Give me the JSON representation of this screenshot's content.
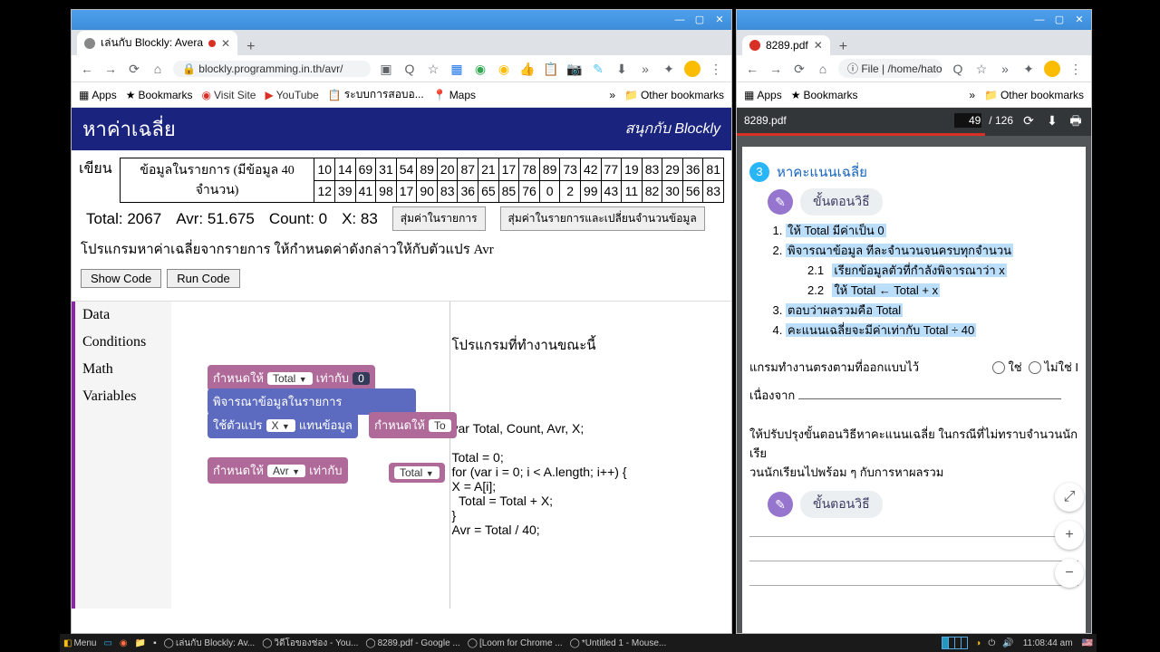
{
  "left": {
    "tab_title": "เล่นกับ Blockly: Avera",
    "url": "blockly.programming.in.th/avr/",
    "bookmarks": [
      "Apps",
      "Bookmarks",
      "Visit Site",
      "YouTube",
      "ระบบการสอบอ...",
      "Maps",
      "Other bookmarks"
    ],
    "page_h1": "หาค่าเฉลี่ย",
    "page_sub": "สนุกกับ Blockly",
    "label_write": "เขียน",
    "data_label": "ข้อมูลในรายการ (มีข้อมูล 40 จำนวน)",
    "nums_r1": [
      "10",
      "14",
      "69",
      "31",
      "54",
      "89",
      "20",
      "87",
      "21",
      "17",
      "78",
      "89",
      "73",
      "42",
      "77",
      "19",
      "83",
      "29",
      "36",
      "81"
    ],
    "nums_r2": [
      "12",
      "39",
      "41",
      "98",
      "17",
      "90",
      "83",
      "36",
      "65",
      "85",
      "76",
      "0",
      "2",
      "99",
      "43",
      "11",
      "82",
      "30",
      "56",
      "83"
    ],
    "stats": {
      "total": "Total: 2067",
      "avr": "Avr: 51.675",
      "count": "Count: 0",
      "x": "X: 83"
    },
    "btn_rand1": "สุ่มค่าในรายการ",
    "btn_rand2": "สุ่มค่าในรายการและเปลี่ยนจำนวนข้อมูล",
    "desc": "โปรแกรมหาค่าเฉลี่ยจากรายการ ให้กำหนดค่าดังกล่าวให้กับตัวแปร Avr",
    "show_code": "Show Code",
    "run_code": "Run Code",
    "cats": [
      "Data",
      "Conditions",
      "Math",
      "Variables"
    ],
    "code_title": "โปรแกรมที่ทำงานขณะนี้",
    "code": "var Total, Count, Avr, X;\n\nTotal = 0;\nfor (var i = 0; i < A.length; i++) {\nX = A[i];\n  Total = Total + X;\n}\nAvr = Total / 40;",
    "b1_a": "กำหนดให้",
    "b1_var": "Total",
    "b1_b": "เท่ากับ",
    "b1_val": "0",
    "b2": "พิจารณาข้อมูลในรายการ",
    "b3_a": "ใช้ตัวแปร",
    "b3_var": "X",
    "b3_b": "แทนข้อมูล",
    "b3_c": "กำหนดให้",
    "b3_d": "To",
    "b4_a": "กำหนดให้",
    "b4_var": "Avr",
    "b4_b": "เท่ากับ",
    "b4_pill": "Total"
  },
  "right": {
    "tab_title": "8289.pdf",
    "url": "File | /home/hatori/D...",
    "bookmarks": [
      "Apps",
      "Bookmarks",
      "Other bookmarks"
    ],
    "pdf_name": "8289.pdf",
    "page": "49",
    "pages": "/ 126",
    "sec_num": "3",
    "sec_title": "หาคะแนนเฉลี่ย",
    "step_label": "ขั้นตอนวิธี",
    "s1": "ให้ Total มีค่าเป็น 0",
    "s2": "พิจารณาข้อมูล ทีละจำนวนจนครบทุกจำนวน",
    "s21_n": "2.1",
    "s21": "เรียกข้อมูลตัวที่กำลังพิจารณาว่า x",
    "s22_n": "2.2",
    "s22": "ให้ Total ← Total + x",
    "s3": "ตอบว่าผลรวมคือ Total",
    "s4": "คะแนนเฉลี่ยจะมีค่าเท่ากับ Total ÷ 40",
    "q1": "แกรมทำงานตรงตามที่ออกแบบไว้",
    "q1a": "ใช่",
    "q1b": "ไม่ใช่",
    "q2": "เนื่องจาก",
    "p2a": "ให้ปรับปรุงขั้นตอนวิธีหาคะแนนเฉลี่ย  ในกรณีที่ไม่ทราบจำนวนนักเรีย",
    "p2b": "วนนักเรียนไปพร้อม ๆ กับการหาผลรวม"
  },
  "taskbar": {
    "menu": "Menu",
    "items": [
      "เล่นกับ Blockly: Av...",
      "วิดีโอของช่อง - You...",
      "8289.pdf - Google ...",
      "[Loom for Chrome ...",
      "*Untitled 1 - Mouse..."
    ],
    "time": "11:08:44 am"
  },
  "chev": "»"
}
